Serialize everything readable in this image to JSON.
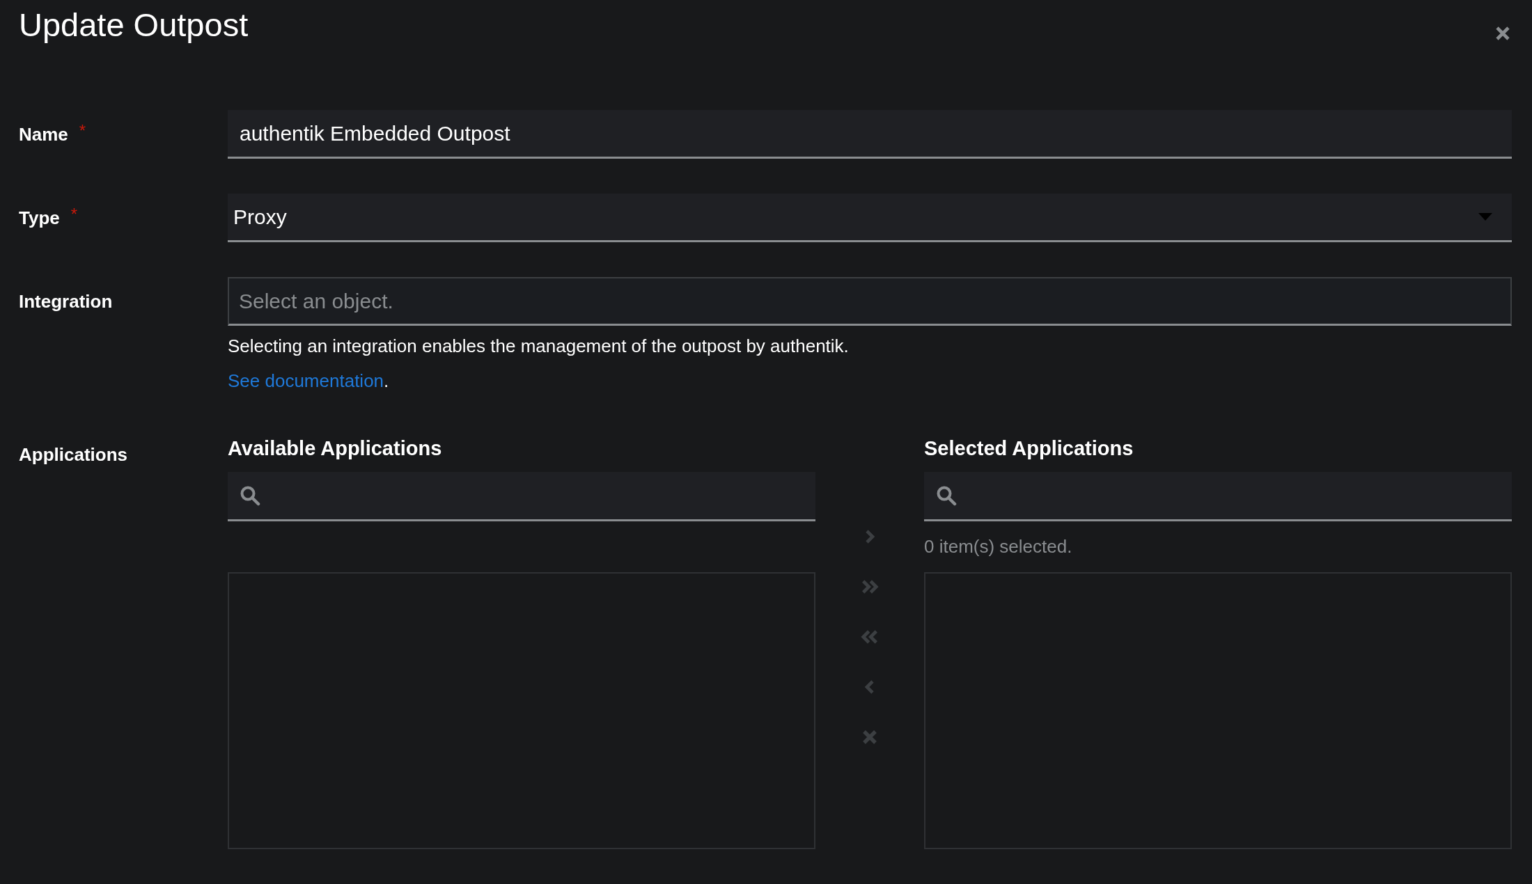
{
  "modal": {
    "title": "Update Outpost"
  },
  "fields": [
    {
      "kind": "text",
      "label": "Name",
      "required_mark": "*",
      "value": "authentik Embedded Outpost"
    },
    {
      "kind": "select",
      "label": "Type",
      "required_mark": "*",
      "value": "Proxy"
    },
    {
      "kind": "search-select",
      "label": "Integration",
      "placeholder": "Select an object.",
      "help": "Selecting an integration enables the management of the outpost by authentik.",
      "link": "See documentation",
      "link_suffix": "."
    },
    {
      "kind": "dual-list",
      "label": "Applications",
      "available": {
        "title": "Available Applications"
      },
      "selected": {
        "title": "Selected Applications",
        "status": "0 item(s) selected."
      },
      "actions": [
        {
          "kind": "add",
          "disabled": true
        },
        {
          "kind": "add-all",
          "disabled": true
        },
        {
          "kind": "remove-all",
          "disabled": true
        },
        {
          "kind": "remove",
          "disabled": true
        },
        {
          "kind": "clear",
          "disabled": true
        }
      ]
    }
  ]
}
